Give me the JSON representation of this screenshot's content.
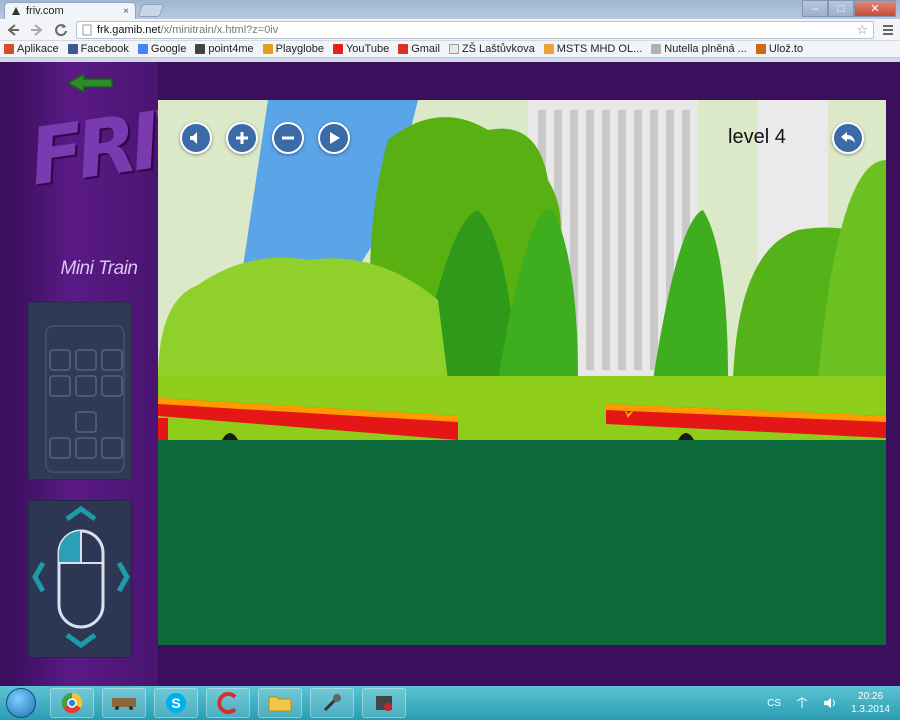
{
  "browser": {
    "tab_title": "friv.com",
    "tab_close": "×",
    "url_host": "frk.gamib.net",
    "url_path": "/x/minitrain/x.html?z=0iv",
    "window_min": "–",
    "window_max": "□",
    "window_close": "✕",
    "star": "☆"
  },
  "bookmarks": [
    {
      "label": "Aplikace",
      "color": "#d64a2e"
    },
    {
      "label": "Facebook",
      "color": "#3b5998"
    },
    {
      "label": "Google",
      "color": "#4285f4"
    },
    {
      "label": "point4me",
      "color": "#444444"
    },
    {
      "label": "Playglobe",
      "color": "#e0a020"
    },
    {
      "label": "YouTube",
      "color": "#e62117"
    },
    {
      "label": "Gmail",
      "color": "#d93025"
    },
    {
      "label": "ZŠ Laštůvkova",
      "color": "#888888"
    },
    {
      "label": "MSTS MHD OL...",
      "color": "#e8a33c"
    },
    {
      "label": "Nutella plněná ...",
      "color": "#b0b0b0"
    },
    {
      "label": "Ulož.to",
      "color": "#cc6a12"
    }
  ],
  "sidebar": {
    "game_title": "Mini Train"
  },
  "game": {
    "level_label": "level 4",
    "colors": {
      "ground_dark": "#0c6a3c",
      "grass": "#8fcd1b",
      "track_red": "#e51616",
      "track_orange": "#ff9a00",
      "hud_button": "#3a6aa8"
    }
  },
  "taskbar": {
    "language": "CS",
    "time": "20:26",
    "date": "1.3.2014"
  }
}
